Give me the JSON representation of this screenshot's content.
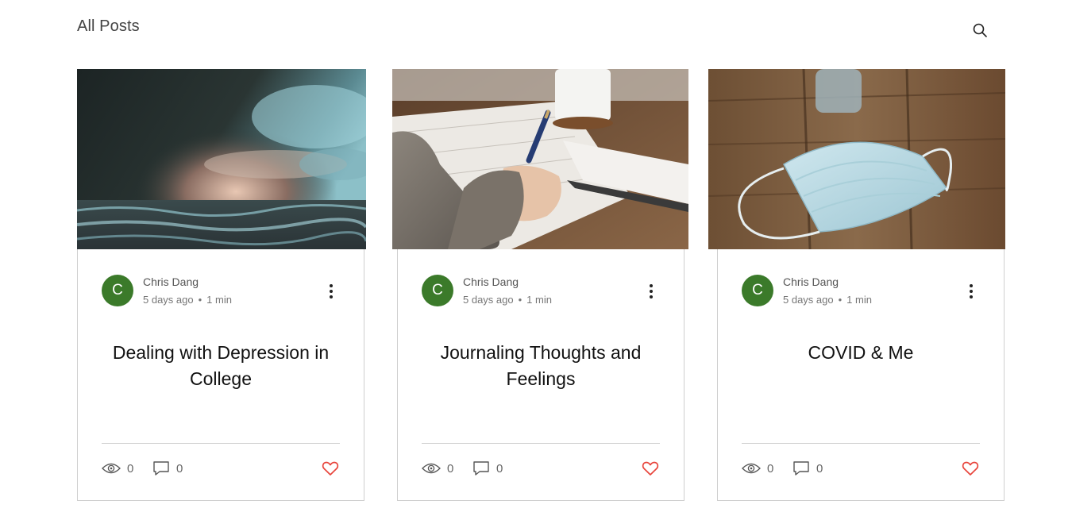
{
  "header": {
    "title": "All Posts",
    "search_icon": "search-icon"
  },
  "colors": {
    "avatar": "#3b7a2a",
    "like": "#e8453c",
    "divider": "#d0d0d0"
  },
  "posts": [
    {
      "author_initial": "C",
      "author": "Chris Dang",
      "date": "5 days ago",
      "read_time": "1 min",
      "title": "Dealing with Depression in College",
      "views": "0",
      "comments": "0",
      "image": "stormy-sea-photo"
    },
    {
      "author_initial": "C",
      "author": "Chris Dang",
      "date": "5 days ago",
      "read_time": "1 min",
      "title": "Journaling Thoughts and Feelings",
      "views": "0",
      "comments": "0",
      "image": "writing-journal-photo"
    },
    {
      "author_initial": "C",
      "author": "Chris Dang",
      "date": "5 days ago",
      "read_time": "1 min",
      "title": "COVID & Me",
      "views": "0",
      "comments": "0",
      "image": "face-mask-photo"
    }
  ]
}
